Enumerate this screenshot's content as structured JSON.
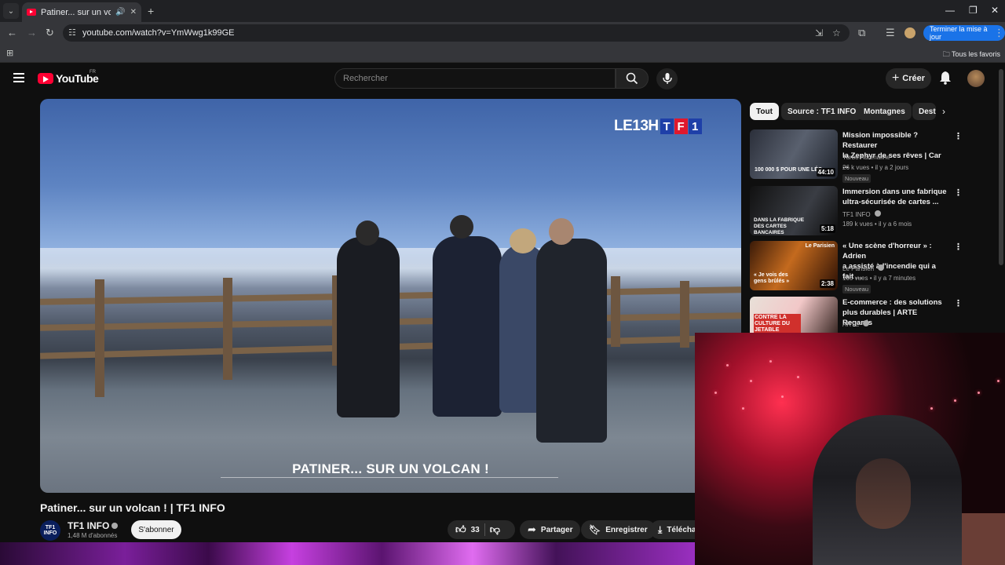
{
  "browser": {
    "tab_title": "Patiner... sur un volcan ! | TF1 INFO - YouTube",
    "url": "youtube.com/watch?v=YmWwg1k99GE",
    "update_button": "Terminer la mise à jour",
    "all_bookmarks": "Tous les favoris"
  },
  "masthead": {
    "logo_text": "YouTube",
    "logo_region": "FR",
    "search_placeholder": "Rechercher",
    "create_label": "Créer"
  },
  "video": {
    "overlay_brand": "LE13H",
    "tf1_letters": [
      "T",
      "F",
      "1"
    ],
    "caption": "PATINER... SUR UN VOLCAN !",
    "title": "Patiner... sur un volcan ! | TF1 INFO",
    "channel_logo": "TF1 INFO",
    "channel": "TF1 INFO",
    "subscribers": "1,48 M d'abonnés",
    "subscribe_label": "S'abonner",
    "likes": "33",
    "share_label": "Partager",
    "save_label": "Enregistrer",
    "download_label": "Téléchar"
  },
  "chips": [
    "Tout",
    "Source : TF1 INFO",
    "Montagnes",
    "Dest"
  ],
  "recommendations": [
    {
      "title_line1": "Mission impossible ? Restaurer",
      "title_line2": "la Zephyr de ses rêves | Car ...",
      "channel": "Turbo Adrénaline",
      "meta": "26 k vues • il y a 2 jours",
      "badge": "Nouveau",
      "duration": "44:10",
      "thumb_text": "100 000 $ POUR UNE LÉG"
    },
    {
      "title_line1": "Immersion dans une fabrique",
      "title_line2": "ultra-sécurisée de cartes ...",
      "channel": "TF1 INFO",
      "meta": "189 k vues • il y a 6 mois",
      "duration": "5:18",
      "thumb_text": "DANS LA FABRIQUE DES CARTES BANCAIRES"
    },
    {
      "title_line1": "« Une scène d'horreur » : Adrien",
      "title_line2": "a assisté à l'incendie qui a fait ...",
      "channel": "Le Parisien",
      "meta": "105 vues • il y a 7 minutes",
      "badge": "Nouveau",
      "duration": "2:38",
      "thumb_text": "« Je vois des gens brûlés »",
      "thumb_brand": "Le Parisien"
    },
    {
      "title_line1": "E-commerce : des solutions",
      "title_line2": "plus durables | ARTE Regards",
      "channel": "ARTE",
      "thumb_text": "CONTRE LA CULTURE DU JETABLE"
    }
  ],
  "colors": {
    "yt_red": "#ff0033",
    "background": "#0f0f0f",
    "update_blue": "#1a73e8"
  },
  "icons": [
    "tab-search-icon",
    "audio-icon",
    "close-icon",
    "back-icon",
    "forward-icon",
    "reload-icon",
    "site-info-icon",
    "install-icon",
    "star-icon",
    "extensions-icon",
    "reading-list-icon",
    "menu-icon",
    "search-icon",
    "mic-icon",
    "bell-icon",
    "like-icon",
    "dislike-icon",
    "share-icon",
    "save-icon",
    "download-icon",
    "kebab-icon"
  ]
}
